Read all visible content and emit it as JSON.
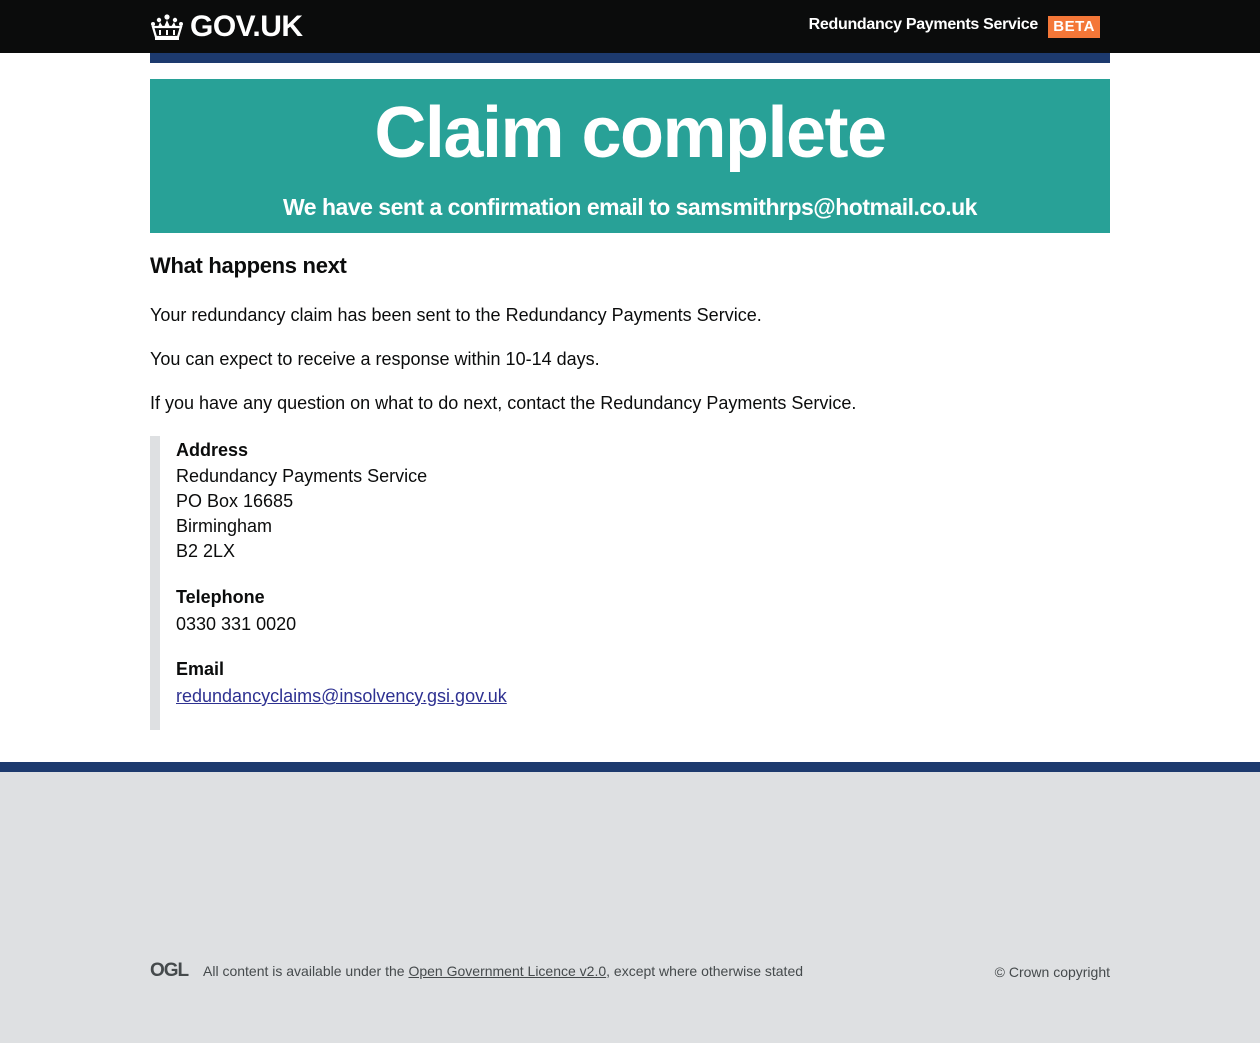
{
  "header": {
    "logo_text": "GOV.UK",
    "service_name": "Redundancy Payments Service",
    "phase_tag": "BETA",
    "colors": {
      "background": "#0b0c0c",
      "tag": "#f47738",
      "accent_bar": "#1d3a6e"
    }
  },
  "confirmation_panel": {
    "title": "Claim complete",
    "body": "We have sent a confirmation email to samsmithrps@hotmail.co.uk",
    "color": "#28a197"
  },
  "main": {
    "heading": "What happens next",
    "paragraphs": [
      "Your redundancy claim has been sent to the Redundancy Payments Service.",
      "You can expect to receive a response within 10-14 days.",
      "If you have any question on what to do next, contact the Redundancy Payments Service."
    ],
    "contact": {
      "address_label": "Address",
      "address_lines": [
        "Redundancy Payments Service",
        "PO Box 16685",
        "Birmingham",
        "B2 2LX"
      ],
      "telephone_label": "Telephone",
      "telephone": "0330 331 0020",
      "email_label": "Email",
      "email": "redundancyclaims@insolvency.gsi.gov.uk"
    }
  },
  "footer": {
    "ogl_logo": "OGL",
    "licence_prefix": "All content is available under the ",
    "licence_link": "Open Government Licence v2.0",
    "licence_suffix": ", except where otherwise stated",
    "copyright": "© Crown copyright"
  }
}
